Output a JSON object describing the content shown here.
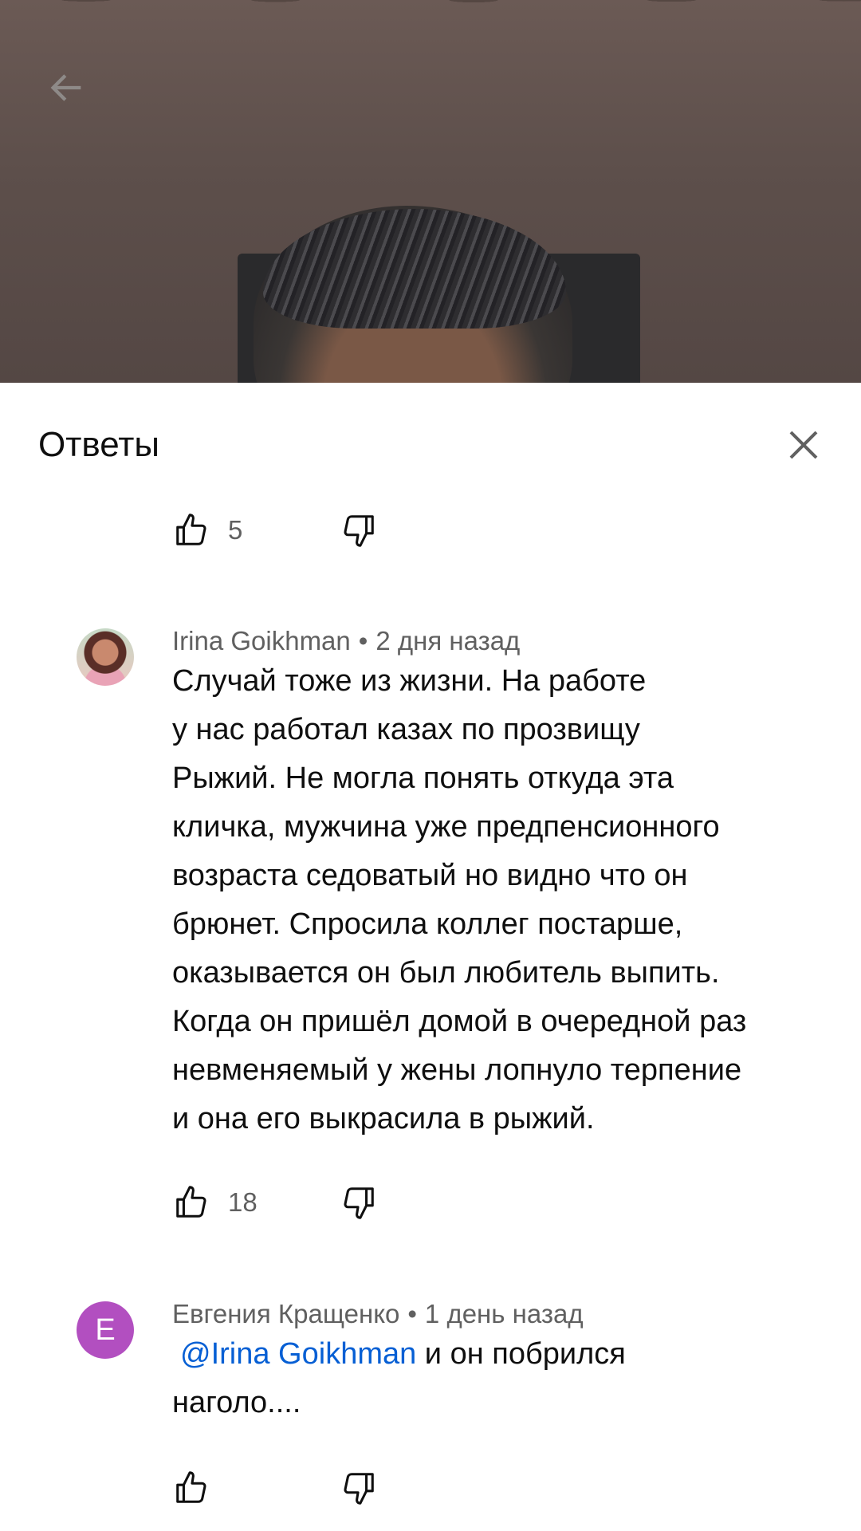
{
  "sheet": {
    "title": "Ответы"
  },
  "previous_comment": {
    "like_count": "5"
  },
  "comments": [
    {
      "author": "Irina Goikhman",
      "separator": "•",
      "time": "2 дня назад",
      "text": "Случай тоже из жизни. На работе\nу нас работал казах по прозвищу\nРыжий. Не могла понять откуда эта\nкличка, мужчина уже предпенсионного\nвозраста седоватый но видно что он\nбрюнет.  Спросила коллег постарше,\nоказывается он был любитель выпить.\nКогда он пришёл домой в очередной раз\nневменяемый у жены лопнуло терпение\nи она его выкрасила в рыжий.",
      "like_count": "18"
    },
    {
      "author": "Евгения Кращенко",
      "separator": "•",
      "time": "1 день назад",
      "avatar_letter": "Е",
      "mention": "@Irina Goikhman",
      "text": " и он побрился\nнаголо....",
      "like_count": ""
    }
  ],
  "icons": {
    "back": "arrow-left-icon",
    "close": "close-icon",
    "like": "thumb-up-icon",
    "dislike": "thumb-down-icon"
  },
  "colors": {
    "accent_link": "#065fd4",
    "avatar_e": "#b24fc0",
    "secondary_text": "#606060"
  }
}
